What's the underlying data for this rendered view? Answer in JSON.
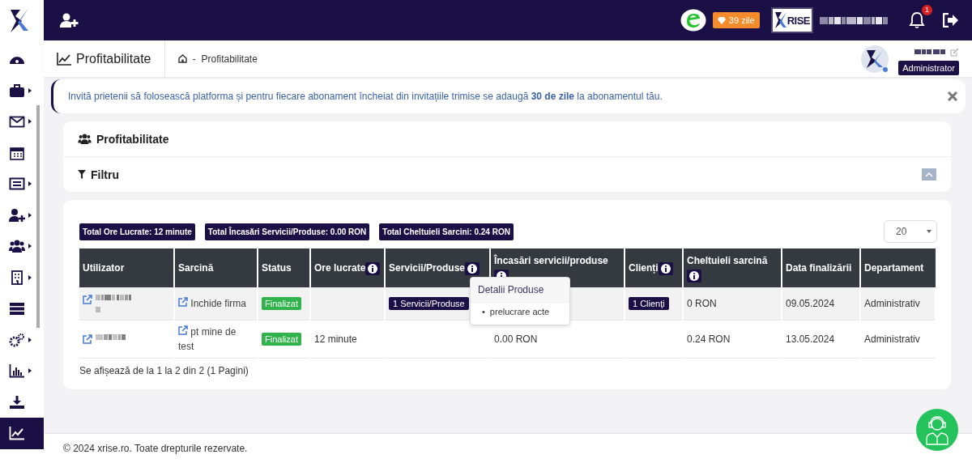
{
  "sidebar": {
    "items": [
      {
        "has_submenu": false,
        "selected": false
      },
      {
        "has_submenu": true,
        "selected": false
      },
      {
        "has_submenu": true,
        "selected": false
      },
      {
        "has_submenu": false,
        "selected": false
      },
      {
        "has_submenu": true,
        "selected": false
      },
      {
        "has_submenu": true,
        "selected": false
      },
      {
        "has_submenu": true,
        "selected": false
      },
      {
        "has_submenu": true,
        "selected": false
      },
      {
        "has_submenu": false,
        "selected": false
      },
      {
        "has_submenu": true,
        "selected": false
      },
      {
        "has_submenu": true,
        "selected": false
      },
      {
        "has_submenu": false,
        "selected": false
      },
      {
        "has_submenu": false,
        "selected": true
      }
    ]
  },
  "topbar": {
    "subscription_badge": "39 zile",
    "company_logo_text": "RISE",
    "notifications_count": "1"
  },
  "page_header": {
    "title": "Profitabilitate",
    "breadcrumb_separator": "-",
    "breadcrumb": "Profitabilitate",
    "user_role": "Administrator"
  },
  "alert": {
    "text": "Invită prietenii să folosească platforma și pentru fiecare abonament încheiat din invitațiile trimise se adaugă **30 de zile** la abonamentul tău."
  },
  "report_card": {
    "title": "Profitabilitate",
    "filter_label": "Filtru"
  },
  "totals": [
    "Total Ore Lucrate: 12 minute",
    "Total Încasări Servicii/Produse: 0.00 RON",
    "Total Cheltuieli Sarcini: 0.24 RON"
  ],
  "page_size": "20",
  "table": {
    "columns": [
      {
        "label": "Utilizator",
        "info": false
      },
      {
        "label": "Sarcină",
        "info": false
      },
      {
        "label": "Status",
        "info": false
      },
      {
        "label": "Ore lucrate",
        "info": true
      },
      {
        "label": "Servicii/Produse",
        "info": true
      },
      {
        "label": "Încasări servicii/produse",
        "info": true
      },
      {
        "label": "Clienți",
        "info": true
      },
      {
        "label": "Cheltuieli sarcină",
        "info": true
      },
      {
        "label": "Data finalizării",
        "info": false
      },
      {
        "label": "Departament",
        "info": false
      }
    ],
    "rows": [
      {
        "task": "Inchide firma",
        "status": "Finalizat",
        "services": "1 Servicii/Produse",
        "clients": "1 Clienți",
        "expenses": "0 RON",
        "date": "09.05.2024",
        "department": "Administrativ"
      },
      {
        "task": "pt mine de test",
        "status": "Finalizat",
        "hours": "12 minute",
        "income": "0.00 RON",
        "expenses": "0.24 RON",
        "date": "13.05.2024",
        "department": "Administrativ"
      }
    ]
  },
  "popover": {
    "title": "Detalii Produse",
    "bullet": "•",
    "items": [
      "prelucrare acte"
    ]
  },
  "pagination_info": "Se afișează de la 1 la 2 din 2 (1 Pagini)",
  "footer": "© 2024 xrise.ro. Toate drepturile rezervate."
}
